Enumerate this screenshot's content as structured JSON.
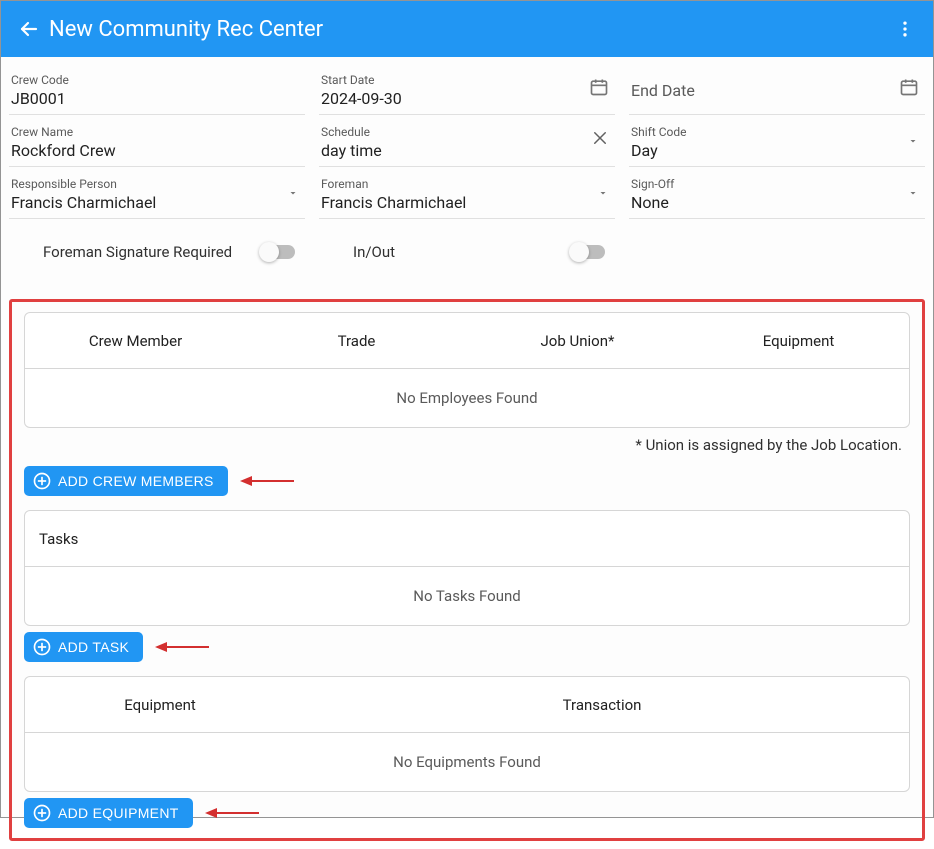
{
  "header": {
    "title": "New Community Rec Center"
  },
  "fields": {
    "crew_code": {
      "label": "Crew Code",
      "value": "JB0001"
    },
    "start_date": {
      "label": "Start Date",
      "value": "2024-09-30"
    },
    "end_date": {
      "placeholder": "End Date"
    },
    "crew_name": {
      "label": "Crew Name",
      "value": "Rockford Crew"
    },
    "schedule": {
      "label": "Schedule",
      "value": "day time"
    },
    "shift_code": {
      "label": "Shift Code",
      "value": "Day"
    },
    "responsible": {
      "label": "Responsible Person",
      "value": "Francis Charmichael"
    },
    "foreman": {
      "label": "Foreman",
      "value": "Francis Charmichael"
    },
    "signoff": {
      "label": "Sign-Off",
      "value": "None"
    }
  },
  "toggles": {
    "foreman_sig": "Foreman Signature Required",
    "inout": "In/Out"
  },
  "crew_panel": {
    "headers": [
      "Crew Member",
      "Trade",
      "Job Union*",
      "Equipment"
    ],
    "empty": "No Employees Found",
    "note": "* Union is assigned by the Job Location.",
    "add_btn": "ADD CREW MEMBERS"
  },
  "tasks_panel": {
    "header": "Tasks",
    "empty": "No Tasks Found",
    "add_btn": "ADD TASK"
  },
  "equip_panel": {
    "headers": [
      "Equipment",
      "Transaction"
    ],
    "empty": "No Equipments Found",
    "add_btn": "ADD EQUIPMENT"
  }
}
